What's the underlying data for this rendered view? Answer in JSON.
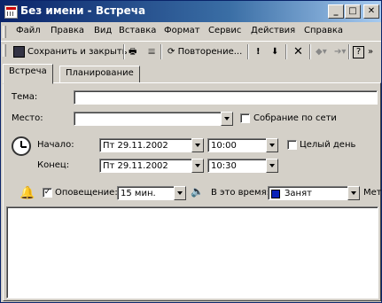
{
  "window": {
    "title": "Без имени - Встреча"
  },
  "menu": [
    "Файл",
    "Правка",
    "Вид",
    "Вставка",
    "Формат",
    "Сервис",
    "Действия",
    "Справка"
  ],
  "toolbar": {
    "save_close": "Сохранить и закрыть",
    "recurrence": "Повторение...",
    "help": "?"
  },
  "tabs": [
    "Встреча",
    "Планирование"
  ],
  "form": {
    "subject_label": "Тема:",
    "subject_value": "",
    "location_label": "Место:",
    "location_value": "",
    "online_meeting_label": "Собрание по сети",
    "start_label": "Начало:",
    "start_date": "Пт 29.11.2002",
    "start_time": "10:00",
    "all_day_label": "Целый день",
    "end_label": "Конец:",
    "end_date": "Пт 29.11.2002",
    "end_time": "10:30",
    "reminder_label": "Оповещение:",
    "reminder_value": "15 мин.",
    "show_time_as_label": "В это время:",
    "show_time_as_value": "Занят",
    "label_truncated": "Мет",
    "reminder_checked": "✓"
  },
  "colors": {
    "busy": "#0a22b8"
  }
}
